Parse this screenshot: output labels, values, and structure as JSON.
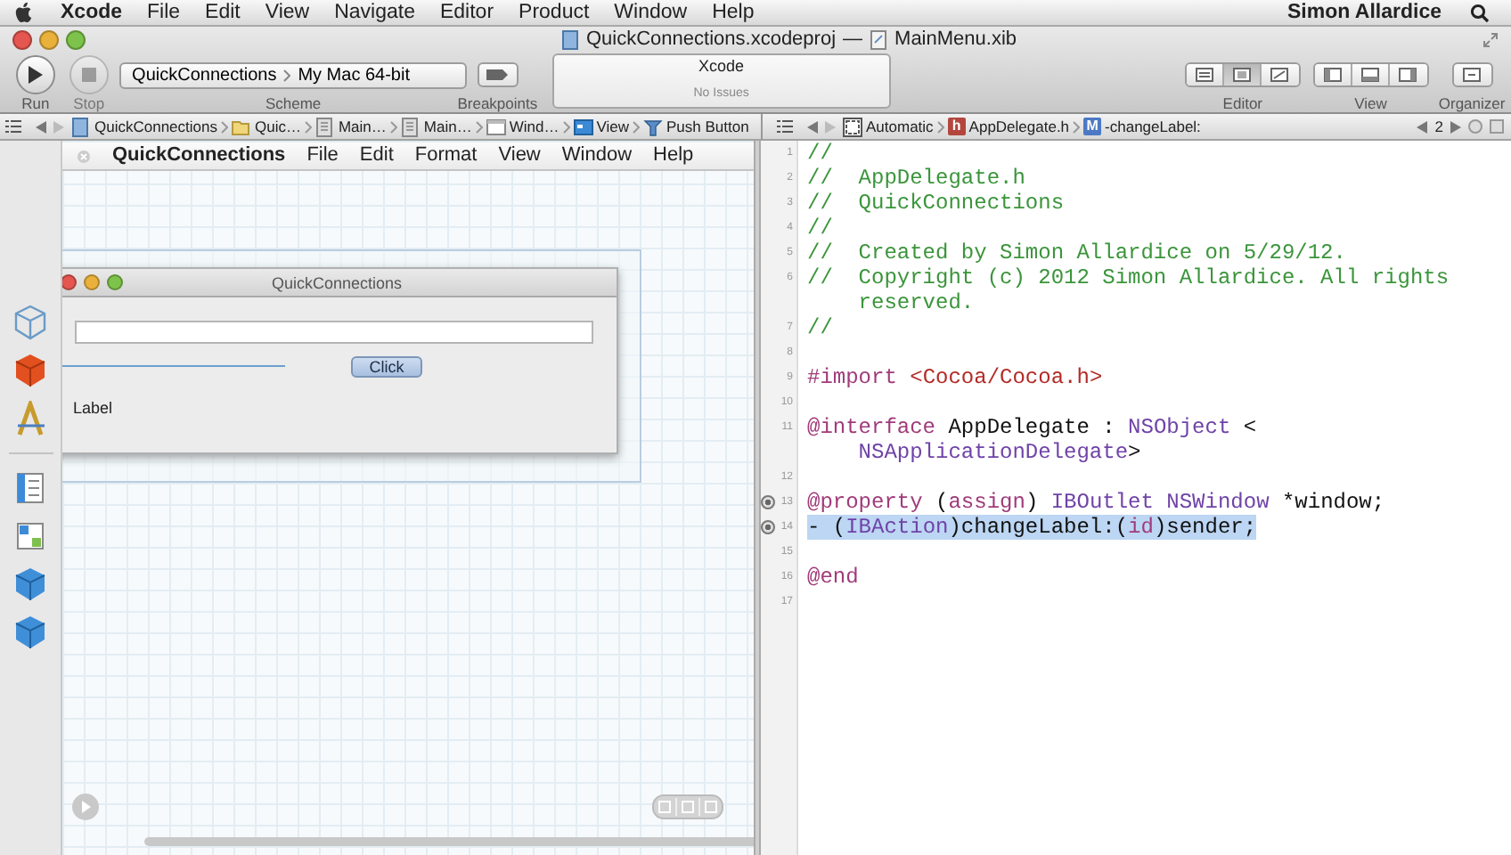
{
  "menu_bar": {
    "app": "Xcode",
    "items": [
      "File",
      "Edit",
      "View",
      "Navigate",
      "Editor",
      "Product",
      "Window",
      "Help"
    ],
    "user": "Simon Allardice"
  },
  "window": {
    "title": "QuickConnections.xcodeproj",
    "separator": "—",
    "document": "MainMenu.xib"
  },
  "toolbar": {
    "run": {
      "label": "Run",
      "disabled": false
    },
    "stop": {
      "label": "Stop",
      "disabled": true
    },
    "scheme": {
      "project": "QuickConnections",
      "destination": "My Mac 64-bit",
      "label": "Scheme"
    },
    "breakpoints": {
      "label": "Breakpoints"
    },
    "activity": {
      "title": "Xcode",
      "status": "No Issues"
    },
    "editor": {
      "label": "Editor",
      "segments": [
        {
          "selected": false
        },
        {
          "selected": true
        },
        {
          "selected": false
        }
      ]
    },
    "view": {
      "label": "View"
    },
    "organizer": {
      "label": "Organizer"
    }
  },
  "ib_jump_bar": {
    "items": [
      {
        "kind": "project",
        "text": "QuickConnections"
      },
      {
        "kind": "folder",
        "text": "Quic…"
      },
      {
        "kind": "file",
        "text": "Main…"
      },
      {
        "kind": "file",
        "text": "Main…"
      },
      {
        "kind": "window",
        "text": "Wind…"
      },
      {
        "kind": "view",
        "text": "View"
      },
      {
        "kind": "button",
        "text": "Push Button"
      }
    ]
  },
  "canvas": {
    "menu": {
      "app": "QuickConnections",
      "items": [
        "File",
        "Edit",
        "Format",
        "View",
        "Window",
        "Help"
      ]
    },
    "window": {
      "title": "QuickConnections",
      "button": "Click",
      "label": "Label"
    }
  },
  "code_jump_bar": {
    "items": [
      {
        "kind": "automatic",
        "text": "Automatic"
      },
      {
        "kind": "header",
        "icon": "h",
        "text": "AppDelegate.h"
      },
      {
        "kind": "method",
        "icon": "M",
        "text": "-changeLabel:"
      }
    ],
    "counter": "2"
  },
  "code": {
    "lines": [
      {
        "number": "1",
        "connected": false,
        "selected": false,
        "tokens": [
          {
            "kind": "comment",
            "text": "//"
          }
        ]
      },
      {
        "number": "2",
        "connected": false,
        "selected": false,
        "tokens": [
          {
            "kind": "comment",
            "text": "//  AppDelegate.h"
          }
        ]
      },
      {
        "number": "3",
        "connected": false,
        "selected": false,
        "tokens": [
          {
            "kind": "comment",
            "text": "//  QuickConnections"
          }
        ]
      },
      {
        "number": "4",
        "connected": false,
        "selected": false,
        "tokens": [
          {
            "kind": "comment",
            "text": "//"
          }
        ]
      },
      {
        "number": "5",
        "connected": false,
        "selected": false,
        "tokens": [
          {
            "kind": "comment",
            "text": "//  Created by Simon Allardice on 5/29/12."
          }
        ]
      },
      {
        "number": "6",
        "connected": false,
        "selected": false,
        "tokens": [
          {
            "kind": "comment",
            "text": "//  Copyright (c) 2012 Simon Allardice. All rights reserved."
          }
        ]
      },
      {
        "number": "7",
        "connected": false,
        "selected": false,
        "tokens": [
          {
            "kind": "comment",
            "text": "//"
          }
        ]
      },
      {
        "number": "8",
        "connected": false,
        "selected": false
      },
      {
        "number": "9",
        "connected": false,
        "selected": false,
        "tokens": [
          {
            "kind": "keyword",
            "text": "#import"
          },
          {
            "kind": "string",
            "text": " <Cocoa/Cocoa.h>"
          }
        ]
      },
      {
        "number": "10",
        "connected": false,
        "selected": false
      },
      {
        "number": "11",
        "connected": false,
        "selected": false,
        "tokens": [
          {
            "kind": "keyword",
            "text": "@interface"
          },
          {
            "kind": "plain",
            "text": " AppDelegate : "
          },
          {
            "kind": "type",
            "text": "NSObject"
          },
          {
            "kind": "plain",
            "text": " <"
          },
          {
            "kind": "type",
            "text": "NSApplicationDelegate"
          },
          {
            "kind": "plain",
            "text": ">"
          }
        ]
      },
      {
        "number": "12",
        "connected": false,
        "selected": false
      },
      {
        "number": "13",
        "connected": true,
        "selected": false,
        "tokens": [
          {
            "kind": "keyword",
            "text": "@property"
          },
          {
            "kind": "plain",
            "text": " ("
          },
          {
            "kind": "keyword",
            "text": "assign"
          },
          {
            "kind": "plain",
            "text": ") "
          },
          {
            "kind": "type",
            "text": "IBOutlet"
          },
          {
            "kind": "type",
            "text": " NSWindow"
          },
          {
            "kind": "plain",
            "text": " *window;"
          }
        ]
      },
      {
        "number": "14",
        "connected": true,
        "selected": true,
        "tokens": [
          {
            "kind": "plain",
            "text": "- ("
          },
          {
            "kind": "type",
            "text": "IBAction"
          },
          {
            "kind": "plain",
            "text": ")changeLabel:("
          },
          {
            "kind": "keyword",
            "text": "id"
          },
          {
            "kind": "plain",
            "text": ")sender;"
          }
        ]
      },
      {
        "number": "15",
        "connected": false,
        "selected": false
      },
      {
        "number": "16",
        "connected": false,
        "selected": false,
        "tokens": [
          {
            "kind": "keyword",
            "text": "@end"
          }
        ]
      },
      {
        "number": "17",
        "connected": false,
        "selected": false
      }
    ]
  }
}
